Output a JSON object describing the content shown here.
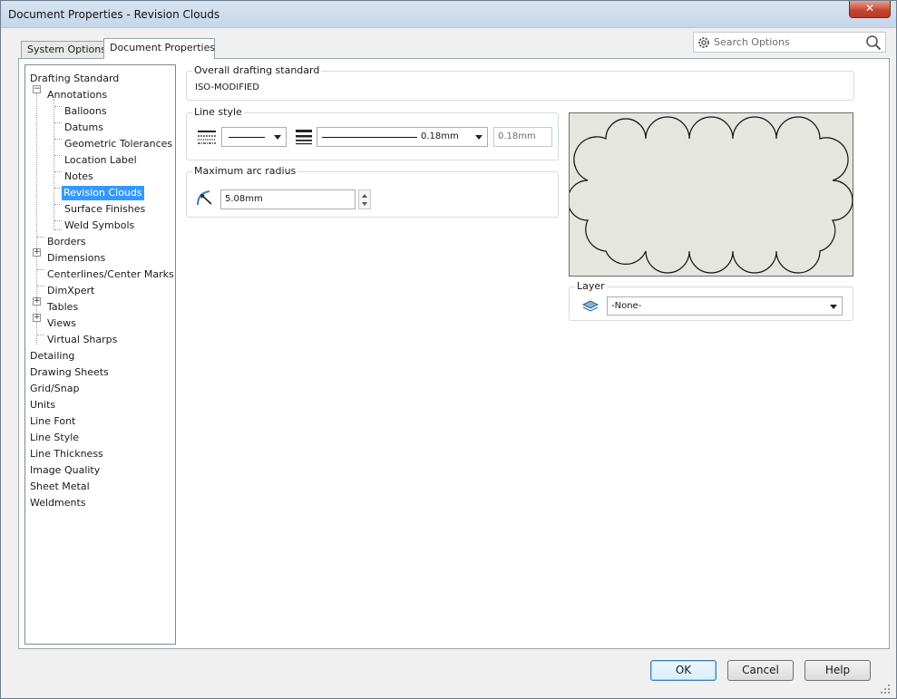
{
  "window": {
    "title": "Document Properties - Revision Clouds",
    "close_label": "✕"
  },
  "tabs": [
    {
      "label": "System Options"
    },
    {
      "label": "Document Properties"
    }
  ],
  "search": {
    "placeholder": "Search Options"
  },
  "tree": {
    "items": [
      {
        "label": "Drafting Standard"
      },
      {
        "label": "Annotations"
      },
      {
        "label": "Balloons"
      },
      {
        "label": "Datums"
      },
      {
        "label": "Geometric Tolerances"
      },
      {
        "label": "Location Label"
      },
      {
        "label": "Notes"
      },
      {
        "label": "Revision Clouds"
      },
      {
        "label": "Surface Finishes"
      },
      {
        "label": "Weld Symbols"
      },
      {
        "label": "Borders"
      },
      {
        "label": "Dimensions"
      },
      {
        "label": "Centerlines/Center Marks"
      },
      {
        "label": "DimXpert"
      },
      {
        "label": "Tables"
      },
      {
        "label": "Views"
      },
      {
        "label": "Virtual Sharps"
      },
      {
        "label": "Detailing"
      },
      {
        "label": "Drawing Sheets"
      },
      {
        "label": "Grid/Snap"
      },
      {
        "label": "Units"
      },
      {
        "label": "Line Font"
      },
      {
        "label": "Line Style"
      },
      {
        "label": "Line Thickness"
      },
      {
        "label": "Image Quality"
      },
      {
        "label": "Sheet Metal"
      },
      {
        "label": "Weldments"
      }
    ],
    "selected": "Revision Clouds"
  },
  "overall": {
    "label": "Overall drafting standard",
    "value": "ISO-MODIFIED"
  },
  "line_style": {
    "label": "Line style",
    "thickness_value": "0.18mm",
    "custom_value": "0.18mm"
  },
  "arc_radius": {
    "label": "Maximum arc radius",
    "value": "5.08mm"
  },
  "layer": {
    "label": "Layer",
    "value": "-None-"
  },
  "buttons": {
    "ok": "OK",
    "cancel": "Cancel",
    "help": "Help"
  },
  "colors": {
    "selection": "#3399ff",
    "preview_bg": "#e6e6e0",
    "close": "#c7422c"
  }
}
